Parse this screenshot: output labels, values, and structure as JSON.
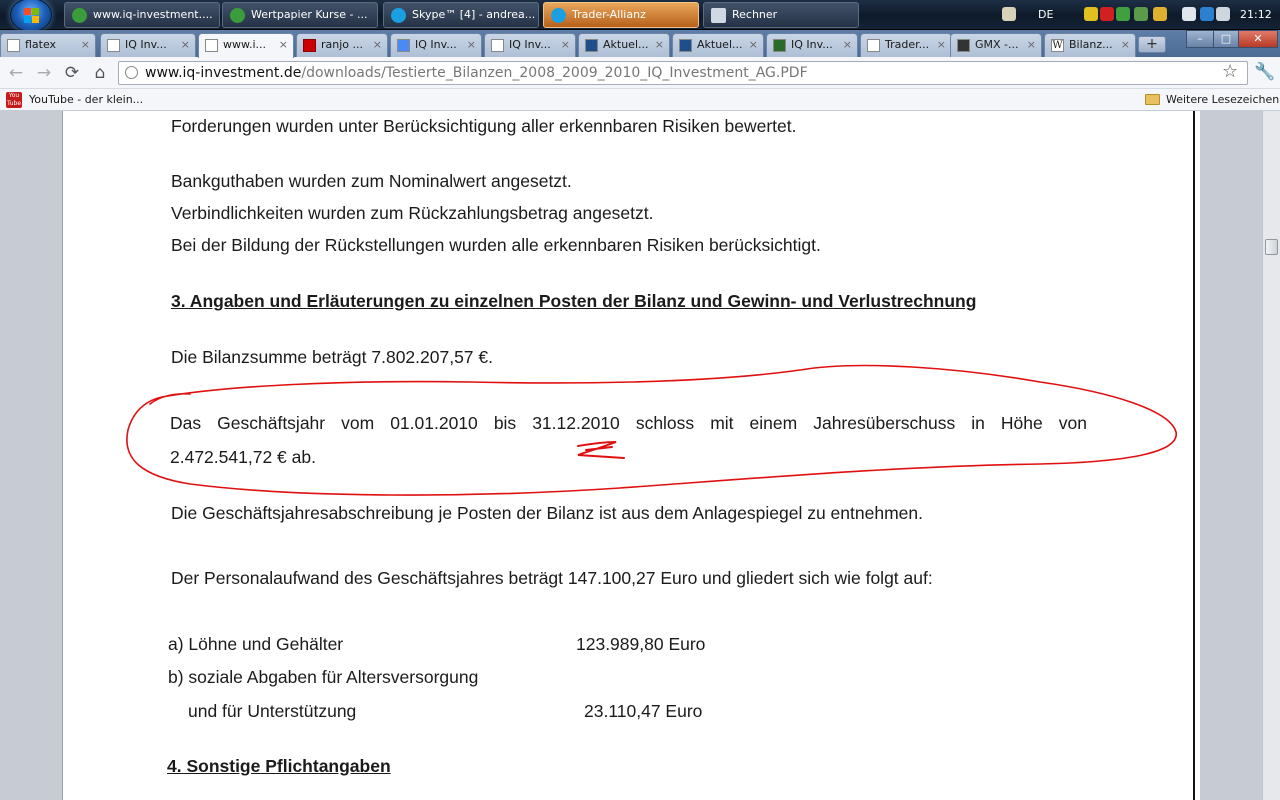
{
  "taskbar": {
    "windows": [
      {
        "label": "www.iq-investment....",
        "color": "#3a9c3a"
      },
      {
        "label": "Wertpapier Kurse - ...",
        "color": "#3a9c3a"
      },
      {
        "label": "Skype™ [4] - andrea...",
        "color": "#1a9fe0"
      },
      {
        "label": "Trader-Allianz",
        "color": "#1a9fe0"
      },
      {
        "label": "Rechner",
        "color": "#cfd8e3"
      }
    ],
    "language": "DE",
    "clock": "21:12"
  },
  "tabs": [
    {
      "label": "flatex"
    },
    {
      "label": "IQ Inv..."
    },
    {
      "label": "www.i..."
    },
    {
      "label": "ranjo ..."
    },
    {
      "label": "IQ Inv..."
    },
    {
      "label": "IQ Inv..."
    },
    {
      "label": "Aktuel..."
    },
    {
      "label": "Aktuel..."
    },
    {
      "label": "IQ Inv..."
    },
    {
      "label": "Trader..."
    },
    {
      "label": "GMX -..."
    },
    {
      "label": "Bilanz..."
    }
  ],
  "new_tab_label": "+",
  "close_glyph": "×",
  "window_controls": {
    "minimize": "–",
    "maximize": "□",
    "close": "✕"
  },
  "address": {
    "host": "www.iq-investment.de",
    "path": "/downloads/Testierte_Bilanzen_2008_2009_2010_IQ_Investment_AG.PDF"
  },
  "nav": {
    "back": "←",
    "forward": "→",
    "reload": "⟳",
    "home": "⌂",
    "star": "☆",
    "wrench": "🔧"
  },
  "bookmarks": {
    "left_item": "YouTube - der klein...",
    "youtube_logo": "You Tube",
    "right_item": "Weitere Lesezeichen"
  },
  "document": {
    "line1": "Forderungen wurden unter Berücksichtigung aller erkennbaren Risiken bewertet.",
    "line2": "Bankguthaben wurden zum Nominalwert angesetzt.",
    "line3": "Verbindlichkeiten wurden zum Rückzahlungsbetrag angesetzt.",
    "line4": "Bei der Bildung der Rückstellungen wurden alle erkennbaren Risiken berücksichtigt.",
    "heading3": "3. Angaben und Erläuterungen zu einzelnen Posten der Bilanz und Gewinn- und Verlustrechnung",
    "bilanzsumme": "Die Bilanzsumme beträgt 7.802.207,57 €.",
    "geschaeftsjahr_words": [
      "Das",
      "Geschäftsjahr",
      "vom",
      "01.01.2010",
      "bis",
      "31.12.2010",
      "schloss",
      "mit",
      "einem",
      "Jahresüberschuss",
      "in",
      "Höhe",
      "von"
    ],
    "geschaeftsjahr_line2": "2.472.541,72 €  ab.",
    "abschreibung": "Die Geschäftsjahresabschreibung je Posten der Bilanz ist aus dem Anlagespiegel zu entnehmen.",
    "personalaufwand": "Der Personalaufwand des Geschäftsjahres beträgt  147.100,27 Euro  und gliedert sich wie folgt auf:",
    "item_a_label": "a) Löhne und Gehälter",
    "item_a_value": "123.989,80 Euro",
    "item_b_label1": "b) soziale Abgaben für Altersversorgung",
    "item_b_label2": "und für Unterstützung",
    "item_b_value": "23.110,47 Euro",
    "heading4": "4. Sonstige Pflichtangaben"
  },
  "colors": {
    "annotation": "#e01010",
    "taskbar_active": "#d98a3a"
  }
}
